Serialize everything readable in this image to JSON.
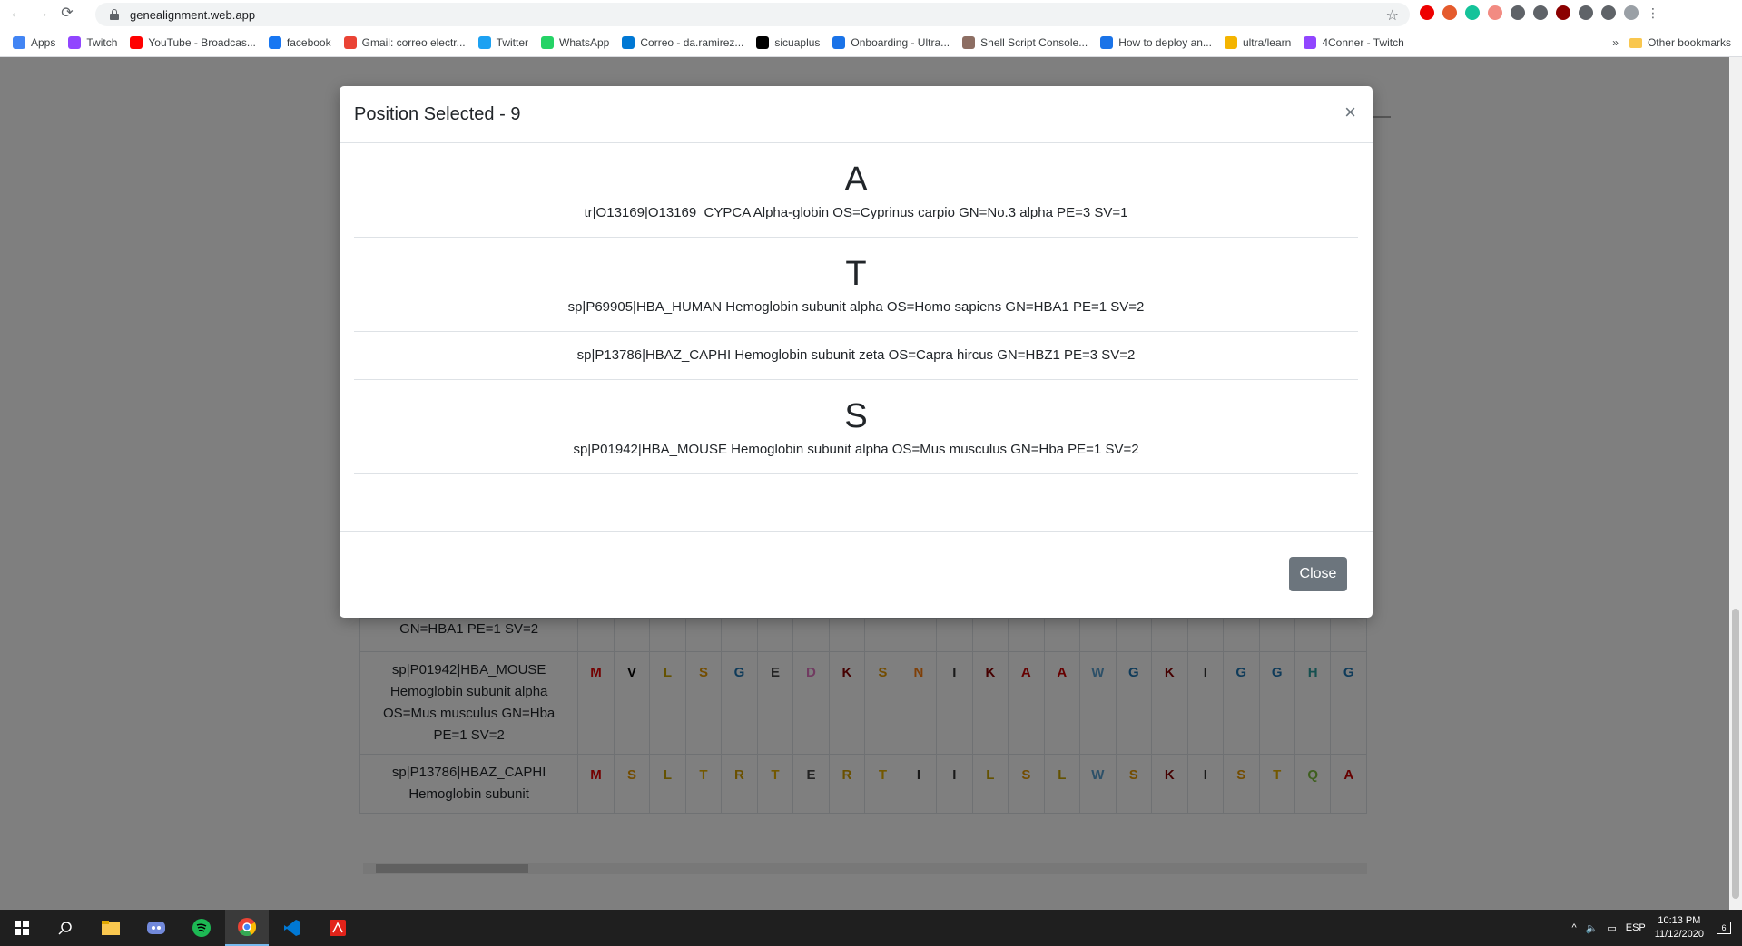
{
  "browser": {
    "url": "genealignment.web.app",
    "bookmarks": [
      {
        "label": "Apps",
        "color": "#4285f4"
      },
      {
        "label": "Twitch",
        "color": "#9146ff"
      },
      {
        "label": "YouTube - Broadcas...",
        "color": "#ff0000"
      },
      {
        "label": "facebook",
        "color": "#1877f2"
      },
      {
        "label": "Gmail: correo electr...",
        "color": "#ea4335"
      },
      {
        "label": "Twitter",
        "color": "#1da1f2"
      },
      {
        "label": "WhatsApp",
        "color": "#25d366"
      },
      {
        "label": "Correo - da.ramirez...",
        "color": "#0078d4"
      },
      {
        "label": "sicuaplus",
        "color": "#000000"
      },
      {
        "label": "Onboarding - Ultra...",
        "color": "#1a73e8"
      },
      {
        "label": "Shell Script Console...",
        "color": "#8d6e63"
      },
      {
        "label": "How to deploy an...",
        "color": "#1a73e8"
      },
      {
        "label": "ultra/learn",
        "color": "#f4b400"
      },
      {
        "label": "4Conner - Twitch",
        "color": "#9146ff"
      }
    ],
    "overflow_label": "»",
    "other_bookmarks": "Other bookmarks"
  },
  "modal": {
    "title": "Position Selected - 9",
    "close_symbol": "×",
    "entries": [
      {
        "letter": "A",
        "description": "tr|O13169|O13169_CYPCA Alpha-globin OS=Cyprinus carpio GN=No.3 alpha PE=3 SV=1"
      },
      {
        "letter": "T",
        "description": "sp|P69905|HBA_HUMAN Hemoglobin subunit alpha OS=Homo sapiens GN=HBA1 PE=1 SV=2"
      },
      {
        "letter": "",
        "description": "sp|P13786|HBAZ_CAPHI Hemoglobin subunit zeta OS=Capra hircus GN=HBZ1 PE=3 SV=2"
      },
      {
        "letter": "S",
        "description": "sp|P01942|HBA_MOUSE Hemoglobin subunit alpha OS=Mus musculus GN=Hba PE=1 SV=2"
      }
    ],
    "close_button": "Close"
  },
  "alignment": {
    "rows": [
      {
        "name": "GN=HBA1 PE=1 SV=2",
        "residues": []
      },
      {
        "name": "sp|P01942|HBA_MOUSE Hemoglobin subunit alpha OS=Mus musculus GN=Hba PE=1 SV=2",
        "residues": [
          "M",
          "V",
          "L",
          "S",
          "G",
          "E",
          "D",
          "K",
          "S",
          "N",
          "I",
          "K",
          "A",
          "A",
          "W",
          "G",
          "K",
          "I",
          "G",
          "G",
          "H",
          "G"
        ]
      },
      {
        "name": "sp|P13786|HBAZ_CAPHI Hemoglobin subunit",
        "residues": [
          "M",
          "S",
          "L",
          "T",
          "R",
          "T",
          "E",
          "R",
          "T",
          "I",
          "I",
          "L",
          "S",
          "L",
          "W",
          "S",
          "K",
          "I",
          "S",
          "T",
          "Q",
          "A"
        ]
      }
    ]
  },
  "residue_colors": {
    "M": "#e60000",
    "V": "#000000",
    "L": "#c8a400",
    "S": "#e69900",
    "G": "#1f77b4",
    "E": "#444444",
    "D": "#e377c2",
    "K": "#8b0000",
    "N": "#ff7f0e",
    "I": "#333333",
    "A": "#cc0000",
    "W": "#5aa0d0",
    "H": "#2ca0a0",
    "T": "#e6b000",
    "R": "#d4a000",
    "Q": "#7fbf3f"
  },
  "taskbar": {
    "language": "ESP",
    "time": "10:13 PM",
    "date": "11/12/2020",
    "notifications": "6"
  }
}
